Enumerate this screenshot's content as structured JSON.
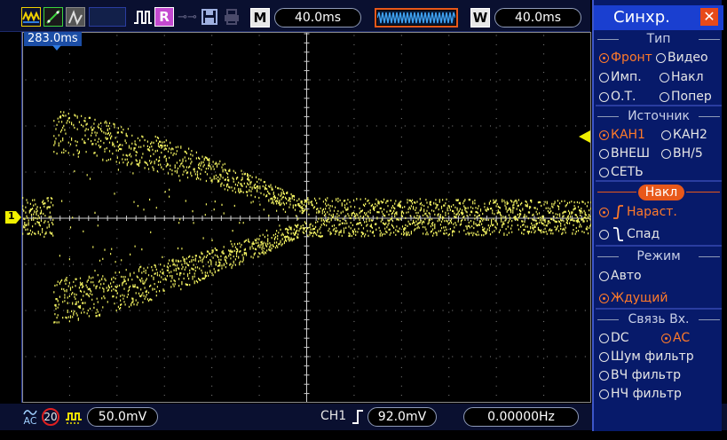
{
  "topbar": {
    "m_label": "M",
    "timebase": "40.0ms",
    "w_label": "W",
    "window_timebase": "40.0ms",
    "r_label": "R"
  },
  "screen": {
    "trigger_time": "283.0ms",
    "channel_marker": "1"
  },
  "bottombar": {
    "coupling": "AC",
    "bw_limit": "20",
    "ch1_scale": "50.0mV",
    "trigger_source": "CH1",
    "trigger_level": "92.0mV",
    "frequency": "0.00000Hz"
  },
  "menu": {
    "title": "Синхр.",
    "close_icon": "close-icon",
    "type_header": "Тип",
    "type_options": [
      {
        "label": "Фронт",
        "selected": true
      },
      {
        "label": "Видео",
        "selected": false
      },
      {
        "label": "Имп.",
        "selected": false
      },
      {
        "label": "Накл",
        "selected": false
      },
      {
        "label": "О.Т.",
        "selected": false
      },
      {
        "label": "Попер",
        "selected": false
      }
    ],
    "source_header": "Источник",
    "source_options": [
      {
        "label": "КАН1",
        "selected": true
      },
      {
        "label": "КАН2",
        "selected": false
      },
      {
        "label": "ВНЕШ",
        "selected": false
      },
      {
        "label": "ВН/5",
        "selected": false
      },
      {
        "label": "СЕТЬ",
        "selected": false
      }
    ],
    "slope_header": "Накл",
    "slope_options": [
      {
        "label": "Нараст.",
        "selected": true
      },
      {
        "label": "Спад",
        "selected": false
      }
    ],
    "mode_header": "Режим",
    "mode_options": [
      {
        "label": "Авто",
        "selected": false
      },
      {
        "label": "Ждущий",
        "selected": true
      }
    ],
    "coupling_header": "Связь  Вх.",
    "coupling_options": [
      {
        "label": "DC",
        "selected": false
      },
      {
        "label": "AC",
        "selected": true
      },
      {
        "label": "Шум  фильтр",
        "selected": false
      },
      {
        "label": "ВЧ  фильтр",
        "selected": false
      },
      {
        "label": "НЧ  фильтр",
        "selected": false
      }
    ]
  },
  "colors": {
    "trace": "#f0f060",
    "accent": "#ff7a2a",
    "menu_bg": "#071a6a",
    "grid": "#8a8a8a"
  }
}
